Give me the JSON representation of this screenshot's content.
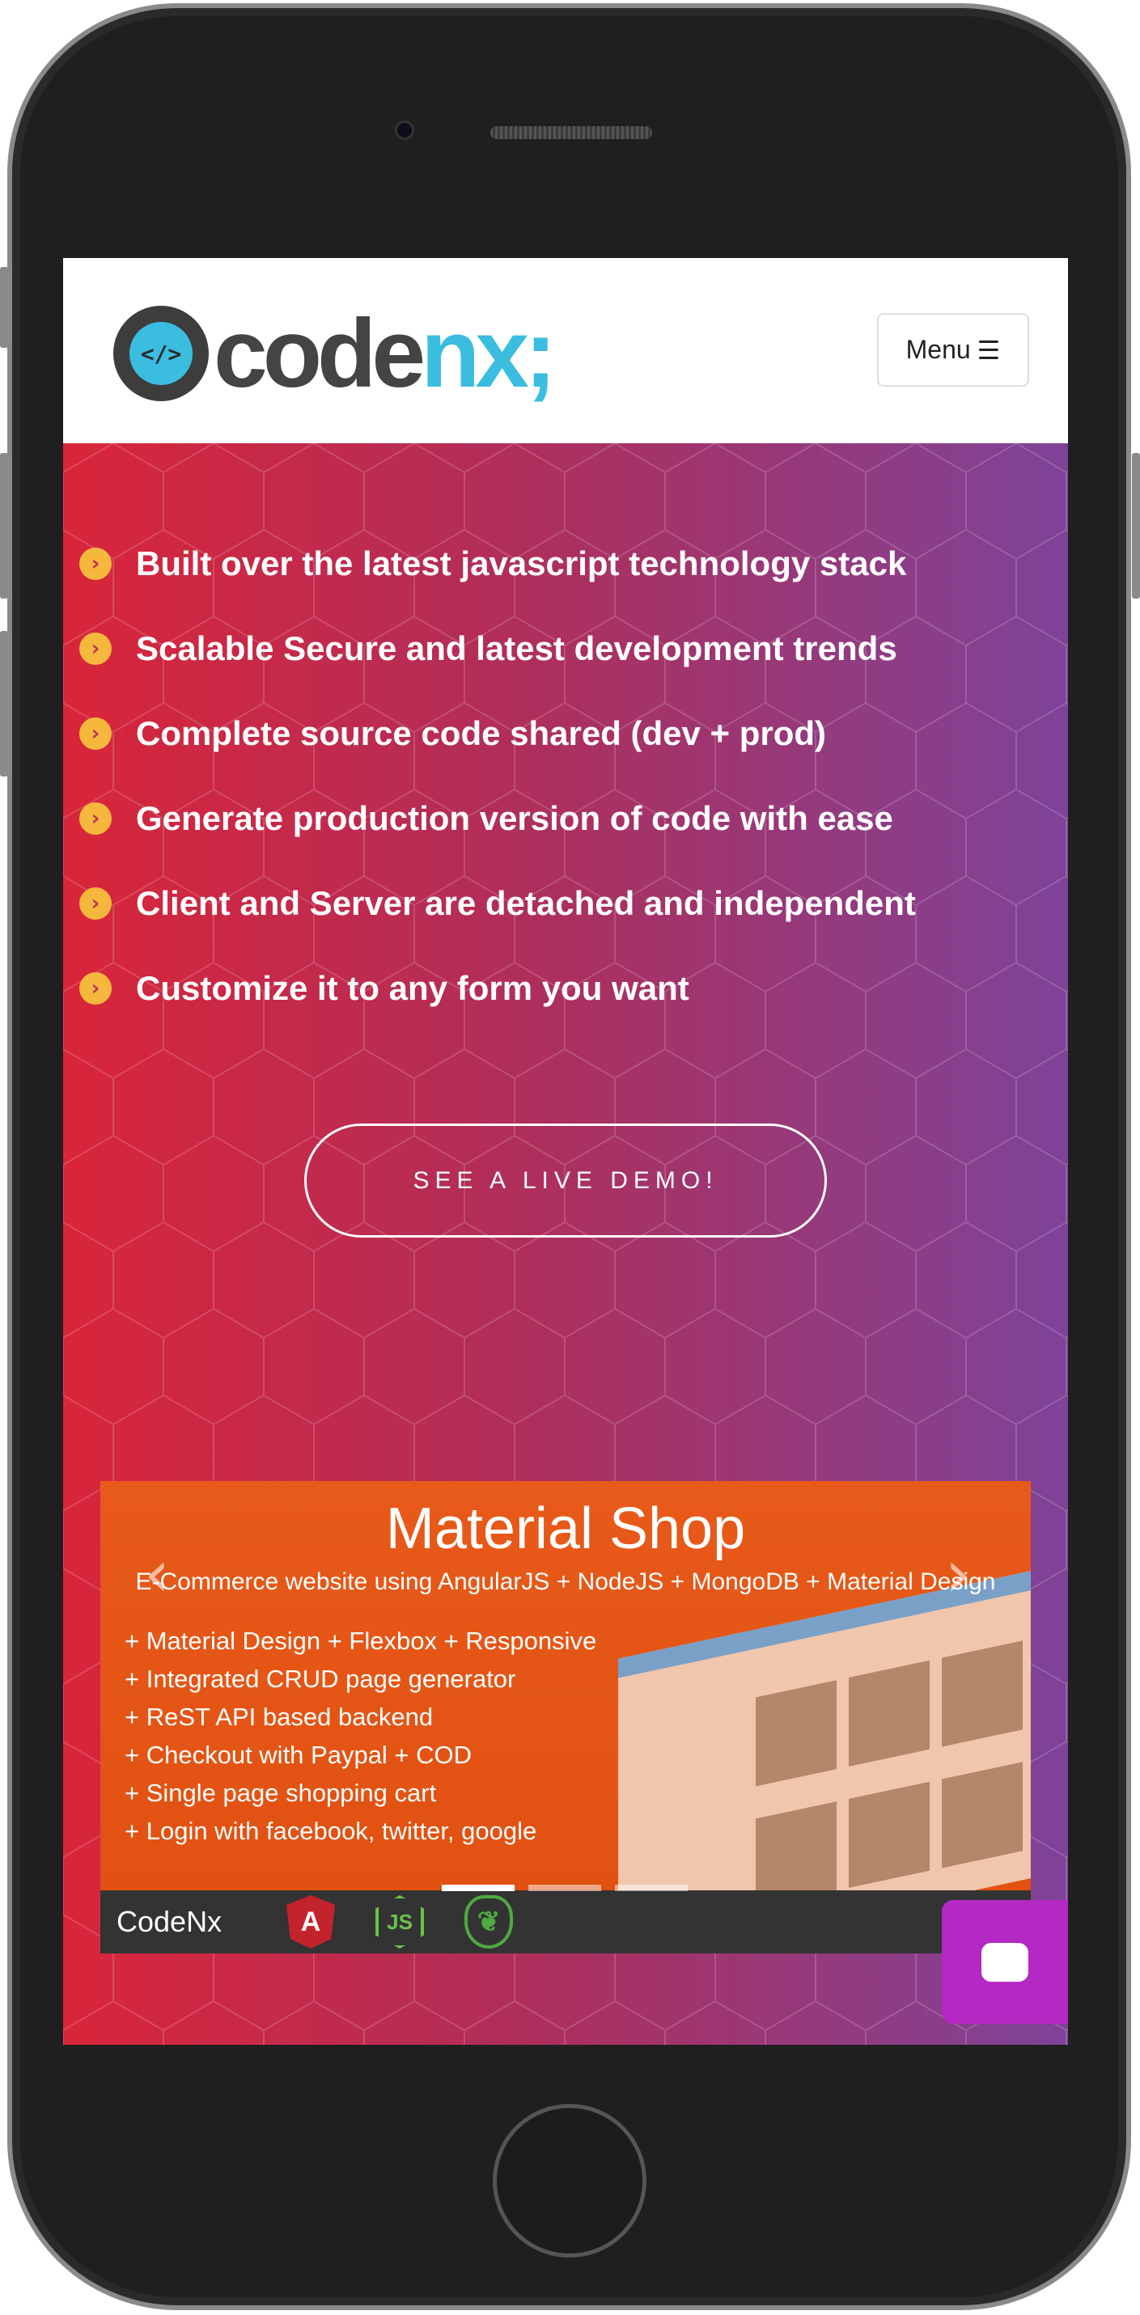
{
  "header": {
    "logo_text_dark": "code",
    "logo_text_accent": "nx;",
    "logo_glyph": "</>",
    "menu_label": "Menu",
    "menu_icon": "bars-icon"
  },
  "features": [
    "Built over the latest javascript technology stack",
    "Scalable Secure and latest development trends",
    "Complete source code shared (dev + prod)",
    "Generate production version of code with ease",
    "Client and Server are detached and independent",
    "Customize it to any form you want"
  ],
  "demo_button": "SEE A LIVE DEMO!",
  "carousel": {
    "title": "Material Shop",
    "subtitle": "E-Commerce website using AngularJS + NodeJS + MongoDB + Material Design",
    "items": [
      "+ Material Design + Flexbox + Responsive",
      "+ Integrated CRUD page generator",
      "+ ReST API based backend",
      "+ Checkout with Paypal + COD",
      "+ Single page shopping cart",
      "+ Login with facebook, twitter, google"
    ],
    "brand": "CodeNx",
    "tech": [
      "A",
      "JS",
      "❦"
    ],
    "slide_count": 3,
    "active_slide": 1
  },
  "colors": {
    "gradient_start": "#d9253a",
    "gradient_end": "#7e4399",
    "accent": "#3bbde0",
    "chat": "#b428c4",
    "bullet": "#f5b83d"
  }
}
